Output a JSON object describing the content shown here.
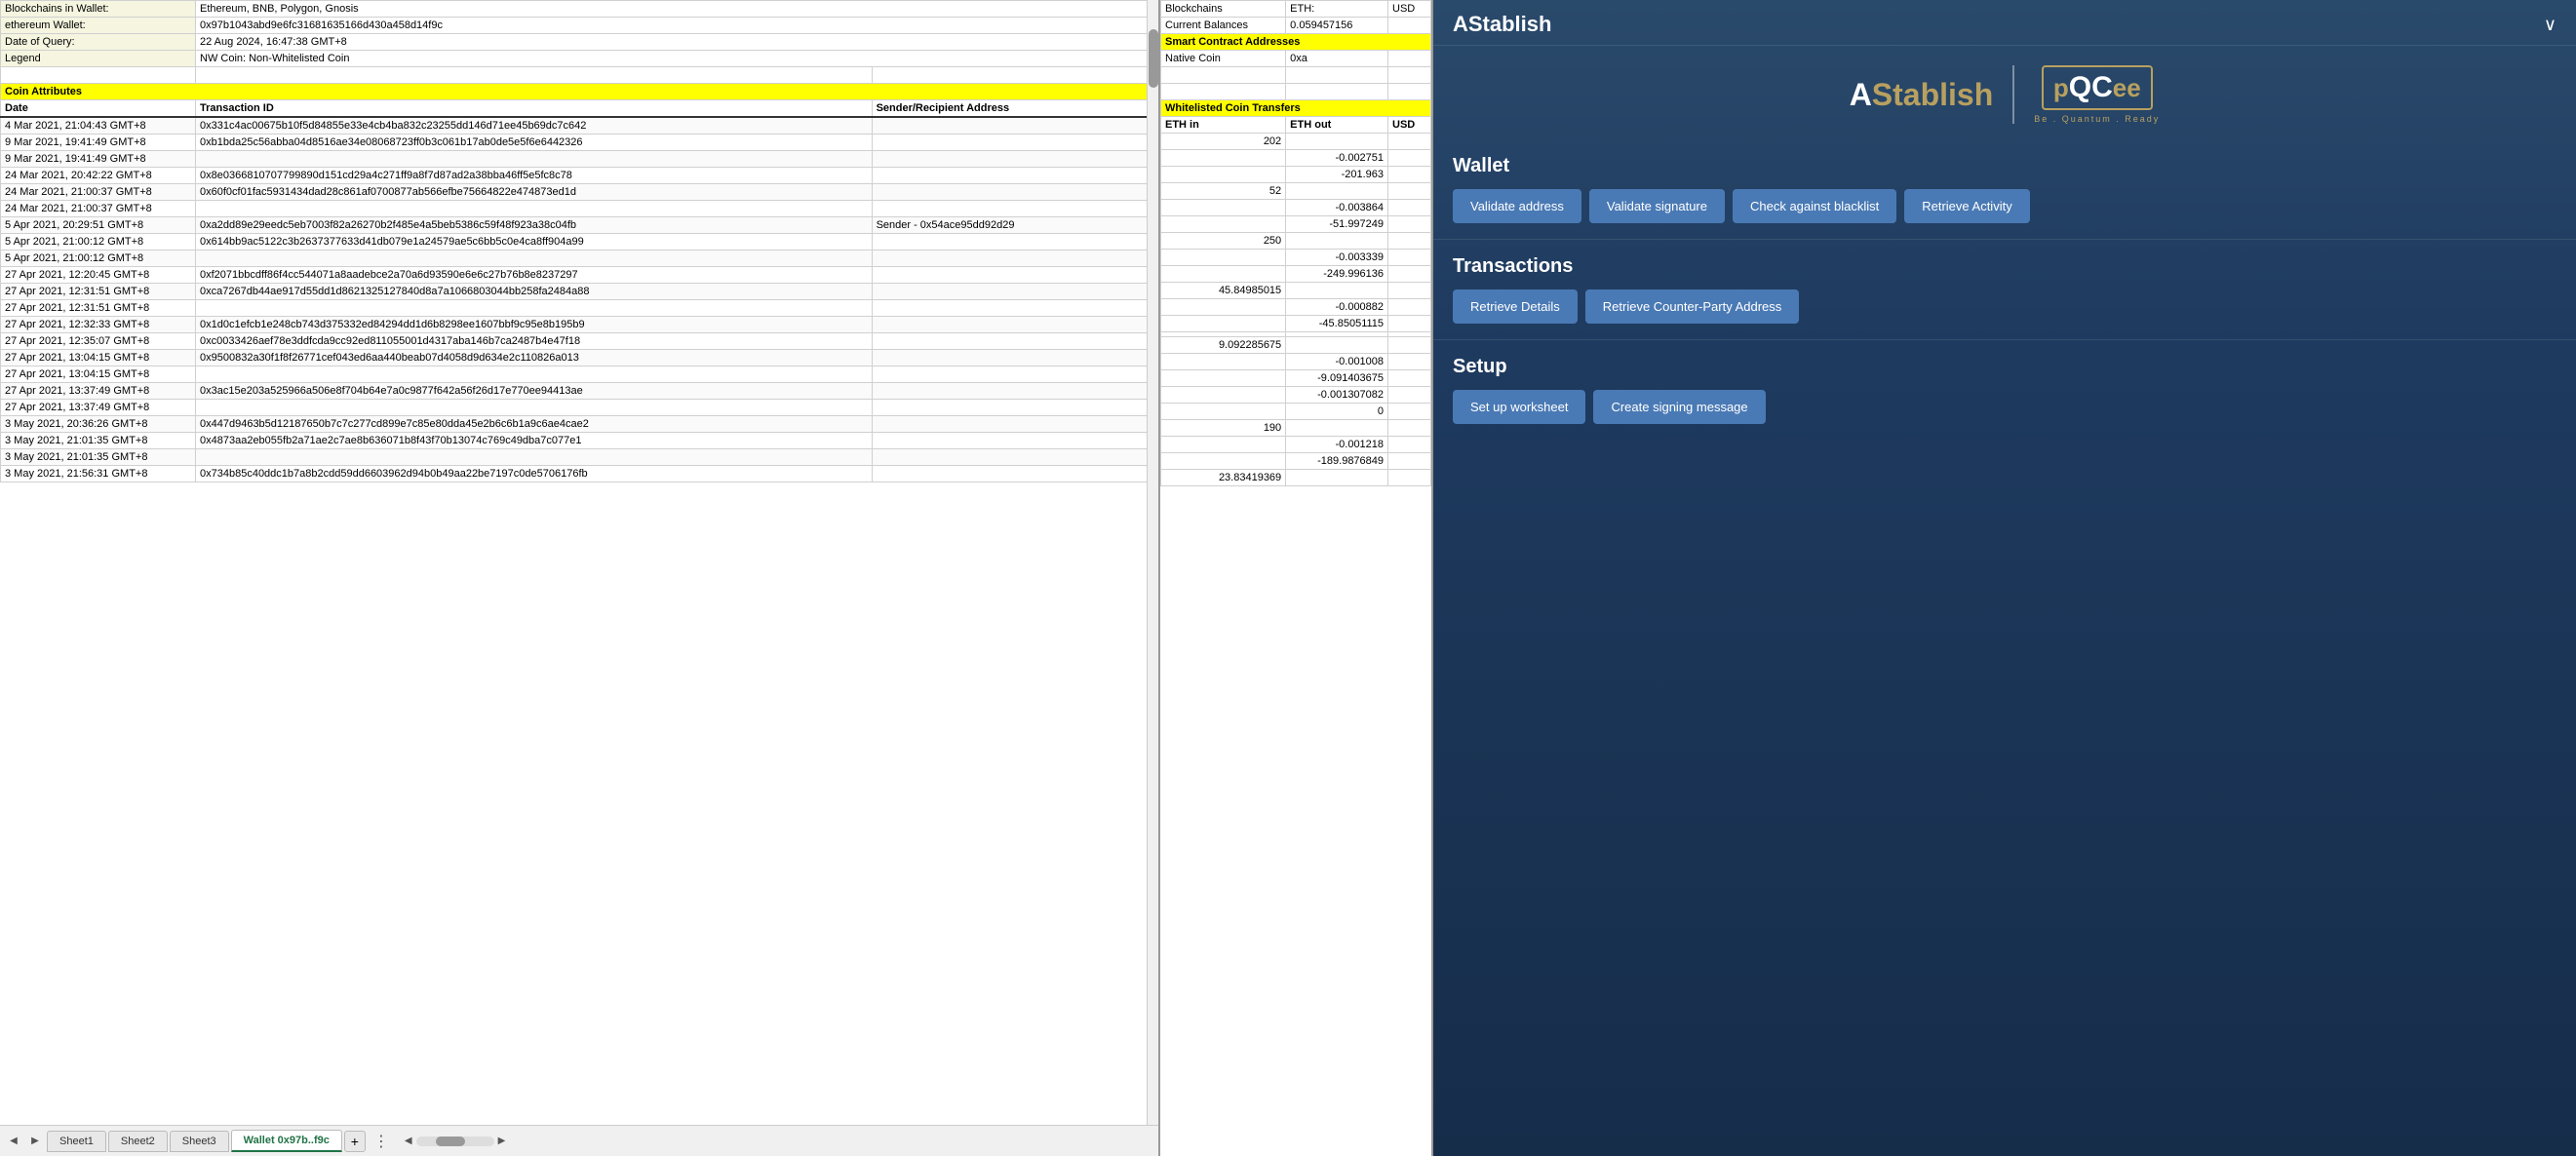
{
  "sidebar": {
    "title": "AStablish",
    "close_label": "∨",
    "logo_a": "A",
    "logo_stablish": "Stablish",
    "logo_pqc": "pQCee",
    "logo_tagline": "Be . Quantum . Ready",
    "wallet_section": "Wallet",
    "transactions_section": "Transactions",
    "setup_section": "Setup",
    "buttons": {
      "validate_address": "Validate address",
      "validate_signature": "Validate signature",
      "check_blacklist": "Check against blacklist",
      "retrieve_activity": "Retrieve Activity",
      "retrieve_details": "Retrieve Details",
      "retrieve_counter_party": "Retrieve Counter-Party Address",
      "set_up_worksheet": "Set up worksheet",
      "create_signing": "Create signing message"
    }
  },
  "spreadsheet": {
    "info_rows": [
      {
        "label": "Blockchains in Wallet:",
        "value": "Ethereum, BNB, Polygon, Gnosis"
      },
      {
        "label": "ethereum Wallet:",
        "value": "0x97b1043abd9e6fc31681635166d430a458d14f9c"
      },
      {
        "label": "Date of Query:",
        "value": "22 Aug 2024, 16:47:38 GMT+8"
      },
      {
        "label": "Legend",
        "value": "NW Coin: Non-Whitelisted Coin"
      }
    ],
    "coin_attributes_label": "Coin Attributes",
    "whitelisted_label": "Whitelisted Coin Transfers",
    "col_headers": [
      "Date",
      "Transaction ID",
      "Sender/Recipient Address",
      "ETH in",
      "ETH out",
      "USD"
    ],
    "transactions": [
      {
        "date": "4 Mar 2021, 21:04:43 GMT+8",
        "txid": "0x331c4ac00675b10f5d84855e33e4cb4ba832c23255dd146d71ee45b69dc7c642",
        "addr": "",
        "eth_in": "202",
        "eth_out": "",
        "usd": ""
      },
      {
        "date": "9 Mar 2021, 19:41:49 GMT+8",
        "txid": "0xb1bda25c56abba04d8516ae34e08068723ff0b3c061b17ab0de5e5f6e6442326",
        "addr": "",
        "eth_in": "",
        "eth_out": "-0.002751",
        "usd": ""
      },
      {
        "date": "9 Mar 2021, 19:41:49 GMT+8",
        "txid": "",
        "addr": "",
        "eth_in": "",
        "eth_out": "-201.963",
        "usd": ""
      },
      {
        "date": "24 Mar 2021, 20:42:22 GMT+8",
        "txid": "0x8e0366810707799890d151cd29a4c271ff9a8f7d87ad2a38bba46ff5e5fc8c78",
        "addr": "",
        "eth_in": "52",
        "eth_out": "",
        "usd": ""
      },
      {
        "date": "24 Mar 2021, 21:00:37 GMT+8",
        "txid": "0x60f0cf01fac5931434dad28c861af0700877ab566efbe75664822e474873ed1d",
        "addr": "",
        "eth_in": "",
        "eth_out": "-0.003864",
        "usd": ""
      },
      {
        "date": "24 Mar 2021, 21:00:37 GMT+8",
        "txid": "",
        "addr": "",
        "eth_in": "",
        "eth_out": "-51.997249",
        "usd": ""
      },
      {
        "date": "5 Apr 2021, 20:29:51 GMT+8",
        "txid": "0xa2dd89e29eedc5eb7003f82a26270b2f485e4a5beb5386c59f48f923a38c04fb",
        "addr": "Sender - 0x54ace95dd92d29",
        "eth_in": "250",
        "eth_out": "",
        "usd": ""
      },
      {
        "date": "5 Apr 2021, 21:00:12 GMT+8",
        "txid": "0x614bb9ac5122c3b2637377633d41db079e1a24579ae5c6bb5c0e4ca8ff904a99",
        "addr": "",
        "eth_in": "",
        "eth_out": "-0.003339",
        "usd": ""
      },
      {
        "date": "5 Apr 2021, 21:00:12 GMT+8",
        "txid": "",
        "addr": "",
        "eth_in": "",
        "eth_out": "-249.996136",
        "usd": ""
      },
      {
        "date": "27 Apr 2021, 12:20:45 GMT+8",
        "txid": "0xf2071bbcdff86f4cc544071a8aadebce2a70a6d93590e6e6c27b76b8e8237297",
        "addr": "",
        "eth_in": "45.84985015",
        "eth_out": "",
        "usd": ""
      },
      {
        "date": "27 Apr 2021, 12:31:51 GMT+8",
        "txid": "0xca7267db44ae917d55dd1d8621325127840d8a7a1066803044bb258fa2484a88",
        "addr": "",
        "eth_in": "",
        "eth_out": "-0.000882",
        "usd": ""
      },
      {
        "date": "27 Apr 2021, 12:31:51 GMT+8",
        "txid": "",
        "addr": "",
        "eth_in": "",
        "eth_out": "-45.85051115",
        "usd": ""
      },
      {
        "date": "27 Apr 2021, 12:32:33 GMT+8",
        "txid": "0x1d0c1efcb1e248cb743d375332ed84294dd1d6b8298ee1607bbf9c95e8b195b9",
        "addr": "",
        "eth_in": "",
        "eth_out": "",
        "usd": ""
      },
      {
        "date": "27 Apr 2021, 12:35:07 GMT+8",
        "txid": "0xc0033426aef78e3ddfcda9cc92ed811055001d4317aba146b7ca2487b4e47f18",
        "addr": "",
        "eth_in": "9.092285675",
        "eth_out": "",
        "usd": ""
      },
      {
        "date": "27 Apr 2021, 13:04:15 GMT+8",
        "txid": "0x9500832a30f1f8f26771cef043ed6aa440beab07d4058d9d634e2c110826a013",
        "addr": "",
        "eth_in": "",
        "eth_out": "-0.001008",
        "usd": ""
      },
      {
        "date": "27 Apr 2021, 13:04:15 GMT+8",
        "txid": "",
        "addr": "",
        "eth_in": "",
        "eth_out": "-9.091403675",
        "usd": ""
      },
      {
        "date": "27 Apr 2021, 13:37:49 GMT+8",
        "txid": "0x3ac15e203a525966a506e8f704b64e7a0c9877f642a56f26d17e770ee94413ae",
        "addr": "",
        "eth_in": "",
        "eth_out": "-0.001307082",
        "usd": ""
      },
      {
        "date": "27 Apr 2021, 13:37:49 GMT+8",
        "txid": "",
        "addr": "",
        "eth_in": "",
        "eth_out": "0",
        "usd": ""
      },
      {
        "date": "3 May 2021, 20:36:26 GMT+8",
        "txid": "0x447d9463b5d12187650b7c7c277cd899e7c85e80dda45e2b6c6b1a9c6ae4cae2",
        "addr": "",
        "eth_in": "190",
        "eth_out": "",
        "usd": ""
      },
      {
        "date": "3 May 2021, 21:01:35 GMT+8",
        "txid": "0x4873aa2eb055fb2a71ae2c7ae8b636071b8f43f70b13074c769c49dba7c077e1",
        "addr": "",
        "eth_in": "",
        "eth_out": "-0.001218",
        "usd": ""
      },
      {
        "date": "3 May 2021, 21:01:35 GMT+8",
        "txid": "",
        "addr": "",
        "eth_in": "",
        "eth_out": "-189.9876849",
        "usd": ""
      },
      {
        "date": "3 May 2021, 21:56:31 GMT+8",
        "txid": "0x734b85c40ddc1b7a8b2cdd59dd6603962d94b0b49aa22be7197c0de5706176fb",
        "addr": "",
        "eth_in": "23.83419369",
        "eth_out": "",
        "usd": ""
      }
    ],
    "tabs": [
      "Sheet1",
      "Sheet2",
      "Sheet3",
      "Wallet 0x97b..f9c"
    ]
  },
  "right_panel": {
    "blockchains_label": "Blockchains",
    "eth_label": "ETH:",
    "usd_label": "USD",
    "current_balances_label": "Current Balances",
    "eth_balance": "0.059457156",
    "smart_contract_header": "Smart Contract Addresses",
    "native_coin_label": "Native Coin",
    "native_coin_addr": "0xa",
    "whitelisted_header": "Whitelisted Coin Transfers",
    "eth_in_label": "ETH in",
    "eth_out_label": "ETH out",
    "usd_col_label": "USD"
  }
}
